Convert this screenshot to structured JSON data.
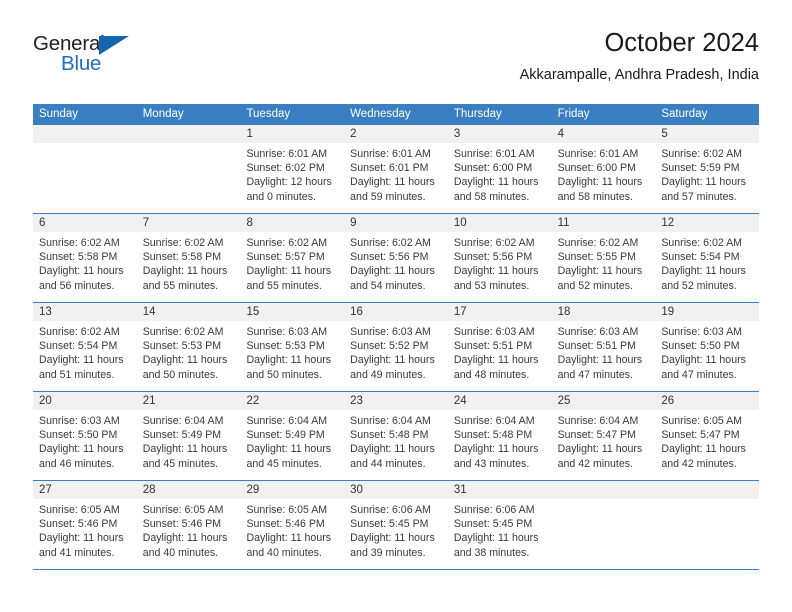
{
  "brand": {
    "name_part1": "General",
    "name_part2": "Blue",
    "logo_icon": "triangle-logo-icon"
  },
  "header": {
    "title": "October 2024",
    "location": "Akkarampalle, Andhra Pradesh, India"
  },
  "colors": {
    "header_blue": "#3a7fc1",
    "logo_blue": "#1665b0",
    "date_strip": "#f1f1f1",
    "text": "#3a3a3a"
  },
  "weekdays": [
    "Sunday",
    "Monday",
    "Tuesday",
    "Wednesday",
    "Thursday",
    "Friday",
    "Saturday"
  ],
  "weeks": [
    {
      "days": [
        {
          "num": "",
          "lines": []
        },
        {
          "num": "",
          "lines": []
        },
        {
          "num": "1",
          "lines": [
            "Sunrise: 6:01 AM",
            "Sunset: 6:02 PM",
            "Daylight: 12 hours",
            "and 0 minutes."
          ]
        },
        {
          "num": "2",
          "lines": [
            "Sunrise: 6:01 AM",
            "Sunset: 6:01 PM",
            "Daylight: 11 hours",
            "and 59 minutes."
          ]
        },
        {
          "num": "3",
          "lines": [
            "Sunrise: 6:01 AM",
            "Sunset: 6:00 PM",
            "Daylight: 11 hours",
            "and 58 minutes."
          ]
        },
        {
          "num": "4",
          "lines": [
            "Sunrise: 6:01 AM",
            "Sunset: 6:00 PM",
            "Daylight: 11 hours",
            "and 58 minutes."
          ]
        },
        {
          "num": "5",
          "lines": [
            "Sunrise: 6:02 AM",
            "Sunset: 5:59 PM",
            "Daylight: 11 hours",
            "and 57 minutes."
          ]
        }
      ]
    },
    {
      "days": [
        {
          "num": "6",
          "lines": [
            "Sunrise: 6:02 AM",
            "Sunset: 5:58 PM",
            "Daylight: 11 hours",
            "and 56 minutes."
          ]
        },
        {
          "num": "7",
          "lines": [
            "Sunrise: 6:02 AM",
            "Sunset: 5:58 PM",
            "Daylight: 11 hours",
            "and 55 minutes."
          ]
        },
        {
          "num": "8",
          "lines": [
            "Sunrise: 6:02 AM",
            "Sunset: 5:57 PM",
            "Daylight: 11 hours",
            "and 55 minutes."
          ]
        },
        {
          "num": "9",
          "lines": [
            "Sunrise: 6:02 AM",
            "Sunset: 5:56 PM",
            "Daylight: 11 hours",
            "and 54 minutes."
          ]
        },
        {
          "num": "10",
          "lines": [
            "Sunrise: 6:02 AM",
            "Sunset: 5:56 PM",
            "Daylight: 11 hours",
            "and 53 minutes."
          ]
        },
        {
          "num": "11",
          "lines": [
            "Sunrise: 6:02 AM",
            "Sunset: 5:55 PM",
            "Daylight: 11 hours",
            "and 52 minutes."
          ]
        },
        {
          "num": "12",
          "lines": [
            "Sunrise: 6:02 AM",
            "Sunset: 5:54 PM",
            "Daylight: 11 hours",
            "and 52 minutes."
          ]
        }
      ]
    },
    {
      "days": [
        {
          "num": "13",
          "lines": [
            "Sunrise: 6:02 AM",
            "Sunset: 5:54 PM",
            "Daylight: 11 hours",
            "and 51 minutes."
          ]
        },
        {
          "num": "14",
          "lines": [
            "Sunrise: 6:02 AM",
            "Sunset: 5:53 PM",
            "Daylight: 11 hours",
            "and 50 minutes."
          ]
        },
        {
          "num": "15",
          "lines": [
            "Sunrise: 6:03 AM",
            "Sunset: 5:53 PM",
            "Daylight: 11 hours",
            "and 50 minutes."
          ]
        },
        {
          "num": "16",
          "lines": [
            "Sunrise: 6:03 AM",
            "Sunset: 5:52 PM",
            "Daylight: 11 hours",
            "and 49 minutes."
          ]
        },
        {
          "num": "17",
          "lines": [
            "Sunrise: 6:03 AM",
            "Sunset: 5:51 PM",
            "Daylight: 11 hours",
            "and 48 minutes."
          ]
        },
        {
          "num": "18",
          "lines": [
            "Sunrise: 6:03 AM",
            "Sunset: 5:51 PM",
            "Daylight: 11 hours",
            "and 47 minutes."
          ]
        },
        {
          "num": "19",
          "lines": [
            "Sunrise: 6:03 AM",
            "Sunset: 5:50 PM",
            "Daylight: 11 hours",
            "and 47 minutes."
          ]
        }
      ]
    },
    {
      "days": [
        {
          "num": "20",
          "lines": [
            "Sunrise: 6:03 AM",
            "Sunset: 5:50 PM",
            "Daylight: 11 hours",
            "and 46 minutes."
          ]
        },
        {
          "num": "21",
          "lines": [
            "Sunrise: 6:04 AM",
            "Sunset: 5:49 PM",
            "Daylight: 11 hours",
            "and 45 minutes."
          ]
        },
        {
          "num": "22",
          "lines": [
            "Sunrise: 6:04 AM",
            "Sunset: 5:49 PM",
            "Daylight: 11 hours",
            "and 45 minutes."
          ]
        },
        {
          "num": "23",
          "lines": [
            "Sunrise: 6:04 AM",
            "Sunset: 5:48 PM",
            "Daylight: 11 hours",
            "and 44 minutes."
          ]
        },
        {
          "num": "24",
          "lines": [
            "Sunrise: 6:04 AM",
            "Sunset: 5:48 PM",
            "Daylight: 11 hours",
            "and 43 minutes."
          ]
        },
        {
          "num": "25",
          "lines": [
            "Sunrise: 6:04 AM",
            "Sunset: 5:47 PM",
            "Daylight: 11 hours",
            "and 42 minutes."
          ]
        },
        {
          "num": "26",
          "lines": [
            "Sunrise: 6:05 AM",
            "Sunset: 5:47 PM",
            "Daylight: 11 hours",
            "and 42 minutes."
          ]
        }
      ]
    },
    {
      "days": [
        {
          "num": "27",
          "lines": [
            "Sunrise: 6:05 AM",
            "Sunset: 5:46 PM",
            "Daylight: 11 hours",
            "and 41 minutes."
          ]
        },
        {
          "num": "28",
          "lines": [
            "Sunrise: 6:05 AM",
            "Sunset: 5:46 PM",
            "Daylight: 11 hours",
            "and 40 minutes."
          ]
        },
        {
          "num": "29",
          "lines": [
            "Sunrise: 6:05 AM",
            "Sunset: 5:46 PM",
            "Daylight: 11 hours",
            "and 40 minutes."
          ]
        },
        {
          "num": "30",
          "lines": [
            "Sunrise: 6:06 AM",
            "Sunset: 5:45 PM",
            "Daylight: 11 hours",
            "and 39 minutes."
          ]
        },
        {
          "num": "31",
          "lines": [
            "Sunrise: 6:06 AM",
            "Sunset: 5:45 PM",
            "Daylight: 11 hours",
            "and 38 minutes."
          ]
        },
        {
          "num": "",
          "lines": []
        },
        {
          "num": "",
          "lines": []
        }
      ]
    }
  ]
}
